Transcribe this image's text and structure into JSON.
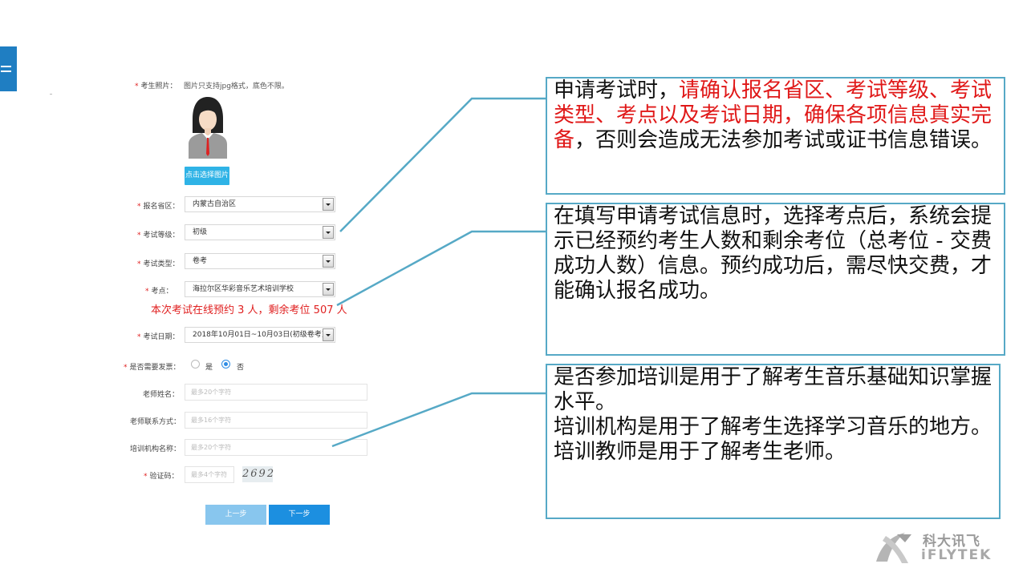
{
  "form": {
    "photo_label": "考生照片：",
    "photo_note": "图片只支持jpg格式，底色不限。",
    "upload_button": "点击选择图片",
    "province": {
      "label": "报名省区：",
      "value": "内蒙古自治区"
    },
    "level": {
      "label": "考试等级：",
      "value": "初级"
    },
    "type": {
      "label": "考试类型：",
      "value": "卷考"
    },
    "site": {
      "label": "考点：",
      "value": "海拉尔区华彩音乐艺术培训学校"
    },
    "seat_message": "本次考试在线预约 3 人，剩余考位 507 人",
    "date": {
      "label": "考试日期：",
      "value": "2018年10月01日~10月03日(初级卷考)"
    },
    "invoice": {
      "label": "是否需要发票：",
      "yes": "是",
      "no": "否",
      "selected": "否"
    },
    "teacher_name": {
      "label": "老师姓名：",
      "placeholder": "最多20个字符"
    },
    "teacher_contact": {
      "label": "老师联系方式：",
      "placeholder": "最多16个字符"
    },
    "institution": {
      "label": "培训机构名称：",
      "placeholder": "最多20个字符"
    },
    "captcha": {
      "label": "验证码：",
      "placeholder": "最多4个字符",
      "code": "2692"
    },
    "prev_button": "上一步",
    "next_button": "下一步"
  },
  "callouts": {
    "c1": {
      "p1": "申请考试时，",
      "p2_red": "请确认报名省区、考试等级、考试类型、考点以及考试日期，确保各项信息真实完备",
      "p3": "，否则会造成无法参加考试或证书信息错误。"
    },
    "c2": "在填写申请考试信息时，选择考点后，系统会提示已经预约考生人数和剩余考位（总考位 - 交费成功人数）信息。预约成功后，需尽快交费，才能确认报名成功。",
    "c3": {
      "l1": "是否参加培训是用于了解考生音乐基础知识掌握水平。",
      "l2": "培训机构是用于了解考生选择学习音乐的地方。",
      "l3": "培训教师是用于了解考生老师。"
    }
  },
  "logo": {
    "cn": "科大讯飞",
    "en": "iFLYTEK"
  },
  "colors": {
    "accent": "#56a9c6",
    "primary_button": "#1c8fe0",
    "highlight": "#e01818"
  }
}
